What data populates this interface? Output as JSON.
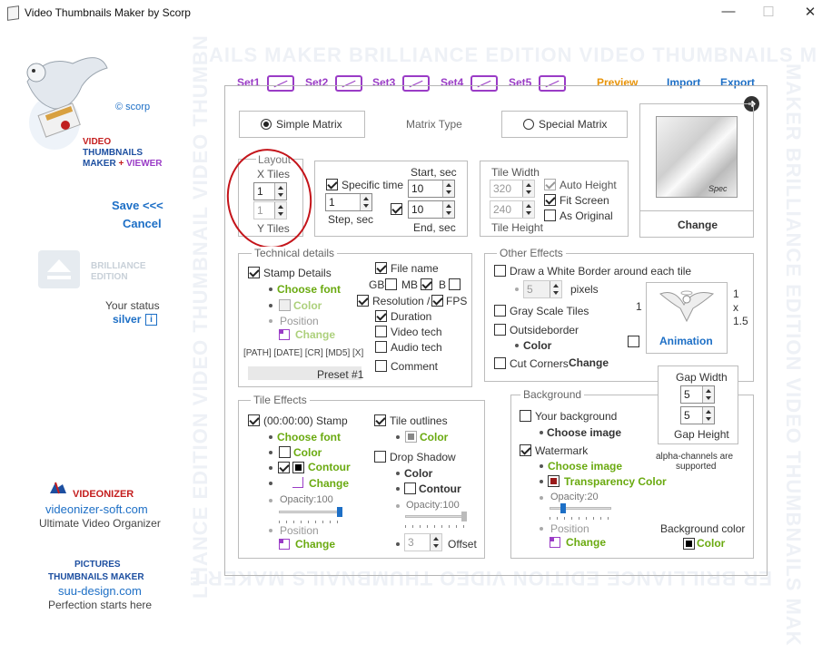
{
  "window": {
    "title": "Video Thumbnails Maker by Scorp",
    "minimize": "—",
    "maximize": "☐",
    "close": "✕"
  },
  "sidebar": {
    "brand_copy": "© scorp",
    "brand_line1": "VIDEO",
    "brand_line2": "THUMBNAILS",
    "brand_line3a": "MAKER",
    "brand_line3b": "+",
    "brand_line3c": "VIEWER",
    "save": "Save <<<",
    "cancel": "Cancel",
    "edition1": "BRILLIANCE",
    "edition2": "EDITION",
    "status_label": "Your status",
    "status_value": "silver",
    "status_icon": "i",
    "videonizer_name": "VIDEONIZER",
    "videonizer_url": "videonizer-soft.com",
    "videonizer_desc": "Ultimate Video Organizer",
    "pictures_line1": "PICTURES",
    "pictures_line2": "THUMBNAILS MAKER",
    "pictures_url": "suu-design.com",
    "pictures_desc": "Perfection starts here"
  },
  "watermark": {
    "top": "AILS MAKER BRILLIANCE EDITION VIDEO THUMBNAILS M",
    "bottom": "ER BRILLIANCE EDITION VIDEO THUMBNAILS MAKER BRI",
    "left": "LLIANCE EDITION VIDEO THUMBNAIL VIDEO THUMBN",
    "right": "MAKER BRILLIANCE EDITION VIDEO THUMBNAILS MAK"
  },
  "tabs": {
    "set1": "Set1",
    "set2": "Set2",
    "set3": "Set3",
    "set4": "Set4",
    "set5": "Set5",
    "preview": "Preview",
    "import": "Import",
    "export": "Export"
  },
  "matrix": {
    "simple": "Simple Matrix",
    "type": "Matrix Type",
    "special": "Special Matrix"
  },
  "preview": {
    "spec": "Spec",
    "change": "Change"
  },
  "layout": {
    "title": "Layout",
    "x_label": "X Tiles",
    "x_value": "1",
    "y_value": "1",
    "y_label": "Y Tiles"
  },
  "timing": {
    "specific_time": "Specific time",
    "start_label": "Start, sec",
    "start_value": "10",
    "step_value": "1",
    "step_label": "Step, sec",
    "end_value": "10",
    "end_label": "End, sec"
  },
  "tile_size": {
    "width_label": "Tile Width",
    "width_value": "320",
    "height_value": "240",
    "height_label": "Tile Height",
    "auto_height": "Auto Height",
    "fit_screen": "Fit Screen",
    "as_original": "As Original"
  },
  "technical": {
    "title": "Technical  details",
    "stamp_details": "Stamp Details",
    "choose_font": "Choose font",
    "color": "Color",
    "position": "Position",
    "change": "Change",
    "file_name": "File name",
    "gb": "GB",
    "mb": "MB",
    "b": "B",
    "resolution": "Resolution /",
    "fps": "FPS",
    "duration": "Duration",
    "video_tech": "Video tech",
    "audio_tech": "Audio tech",
    "comment": "Comment",
    "tokens": "[PATH] [DATE] [CR] [MD5]  [X]",
    "preset": "Preset #1"
  },
  "other_effects": {
    "title": "Other Effects",
    "white_border": "Draw a White Border around each tile",
    "pixels_value": "5",
    "pixels": "pixels",
    "gray_scale": "Gray Scale Tiles",
    "outside_border": "Outsideborder",
    "color": "Color",
    "cut_corners": "Cut Corners",
    "change": "Change",
    "one": "1",
    "right_1": "1",
    "right_x": "x",
    "right_15": "1.5",
    "animation": "Animation"
  },
  "gap": {
    "width_label": "Gap Width",
    "width_value": "5",
    "height_value": "5",
    "height_label": "Gap Height",
    "note1": "alpha-channels are",
    "note2": "supported"
  },
  "tile_effects": {
    "title": "Tile Effects",
    "stamp": "(00:00:00) Stamp",
    "choose_font": "Choose font",
    "color": "Color",
    "contour": "Contour",
    "change": "Change",
    "opacity": "Opacity:100",
    "position": "Position",
    "position_change": "Change",
    "tile_outlines": "Tile outlines",
    "outline_color": "Color",
    "drop_shadow": "Drop Shadow",
    "shadow_color": "Color",
    "shadow_contour": "Contour",
    "shadow_opacity": "Opacity:100",
    "offset_value": "3",
    "offset": "Offset"
  },
  "background": {
    "title": "Background",
    "your_background": "Your background",
    "choose_image": "Choose image",
    "watermark": "Watermark",
    "wm_choose_image": "Choose image",
    "transparency": "Transparency Color",
    "opacity": "Opacity:20",
    "position": "Position",
    "change": "Change",
    "bg_color_label": "Background color",
    "bg_color": "Color"
  }
}
